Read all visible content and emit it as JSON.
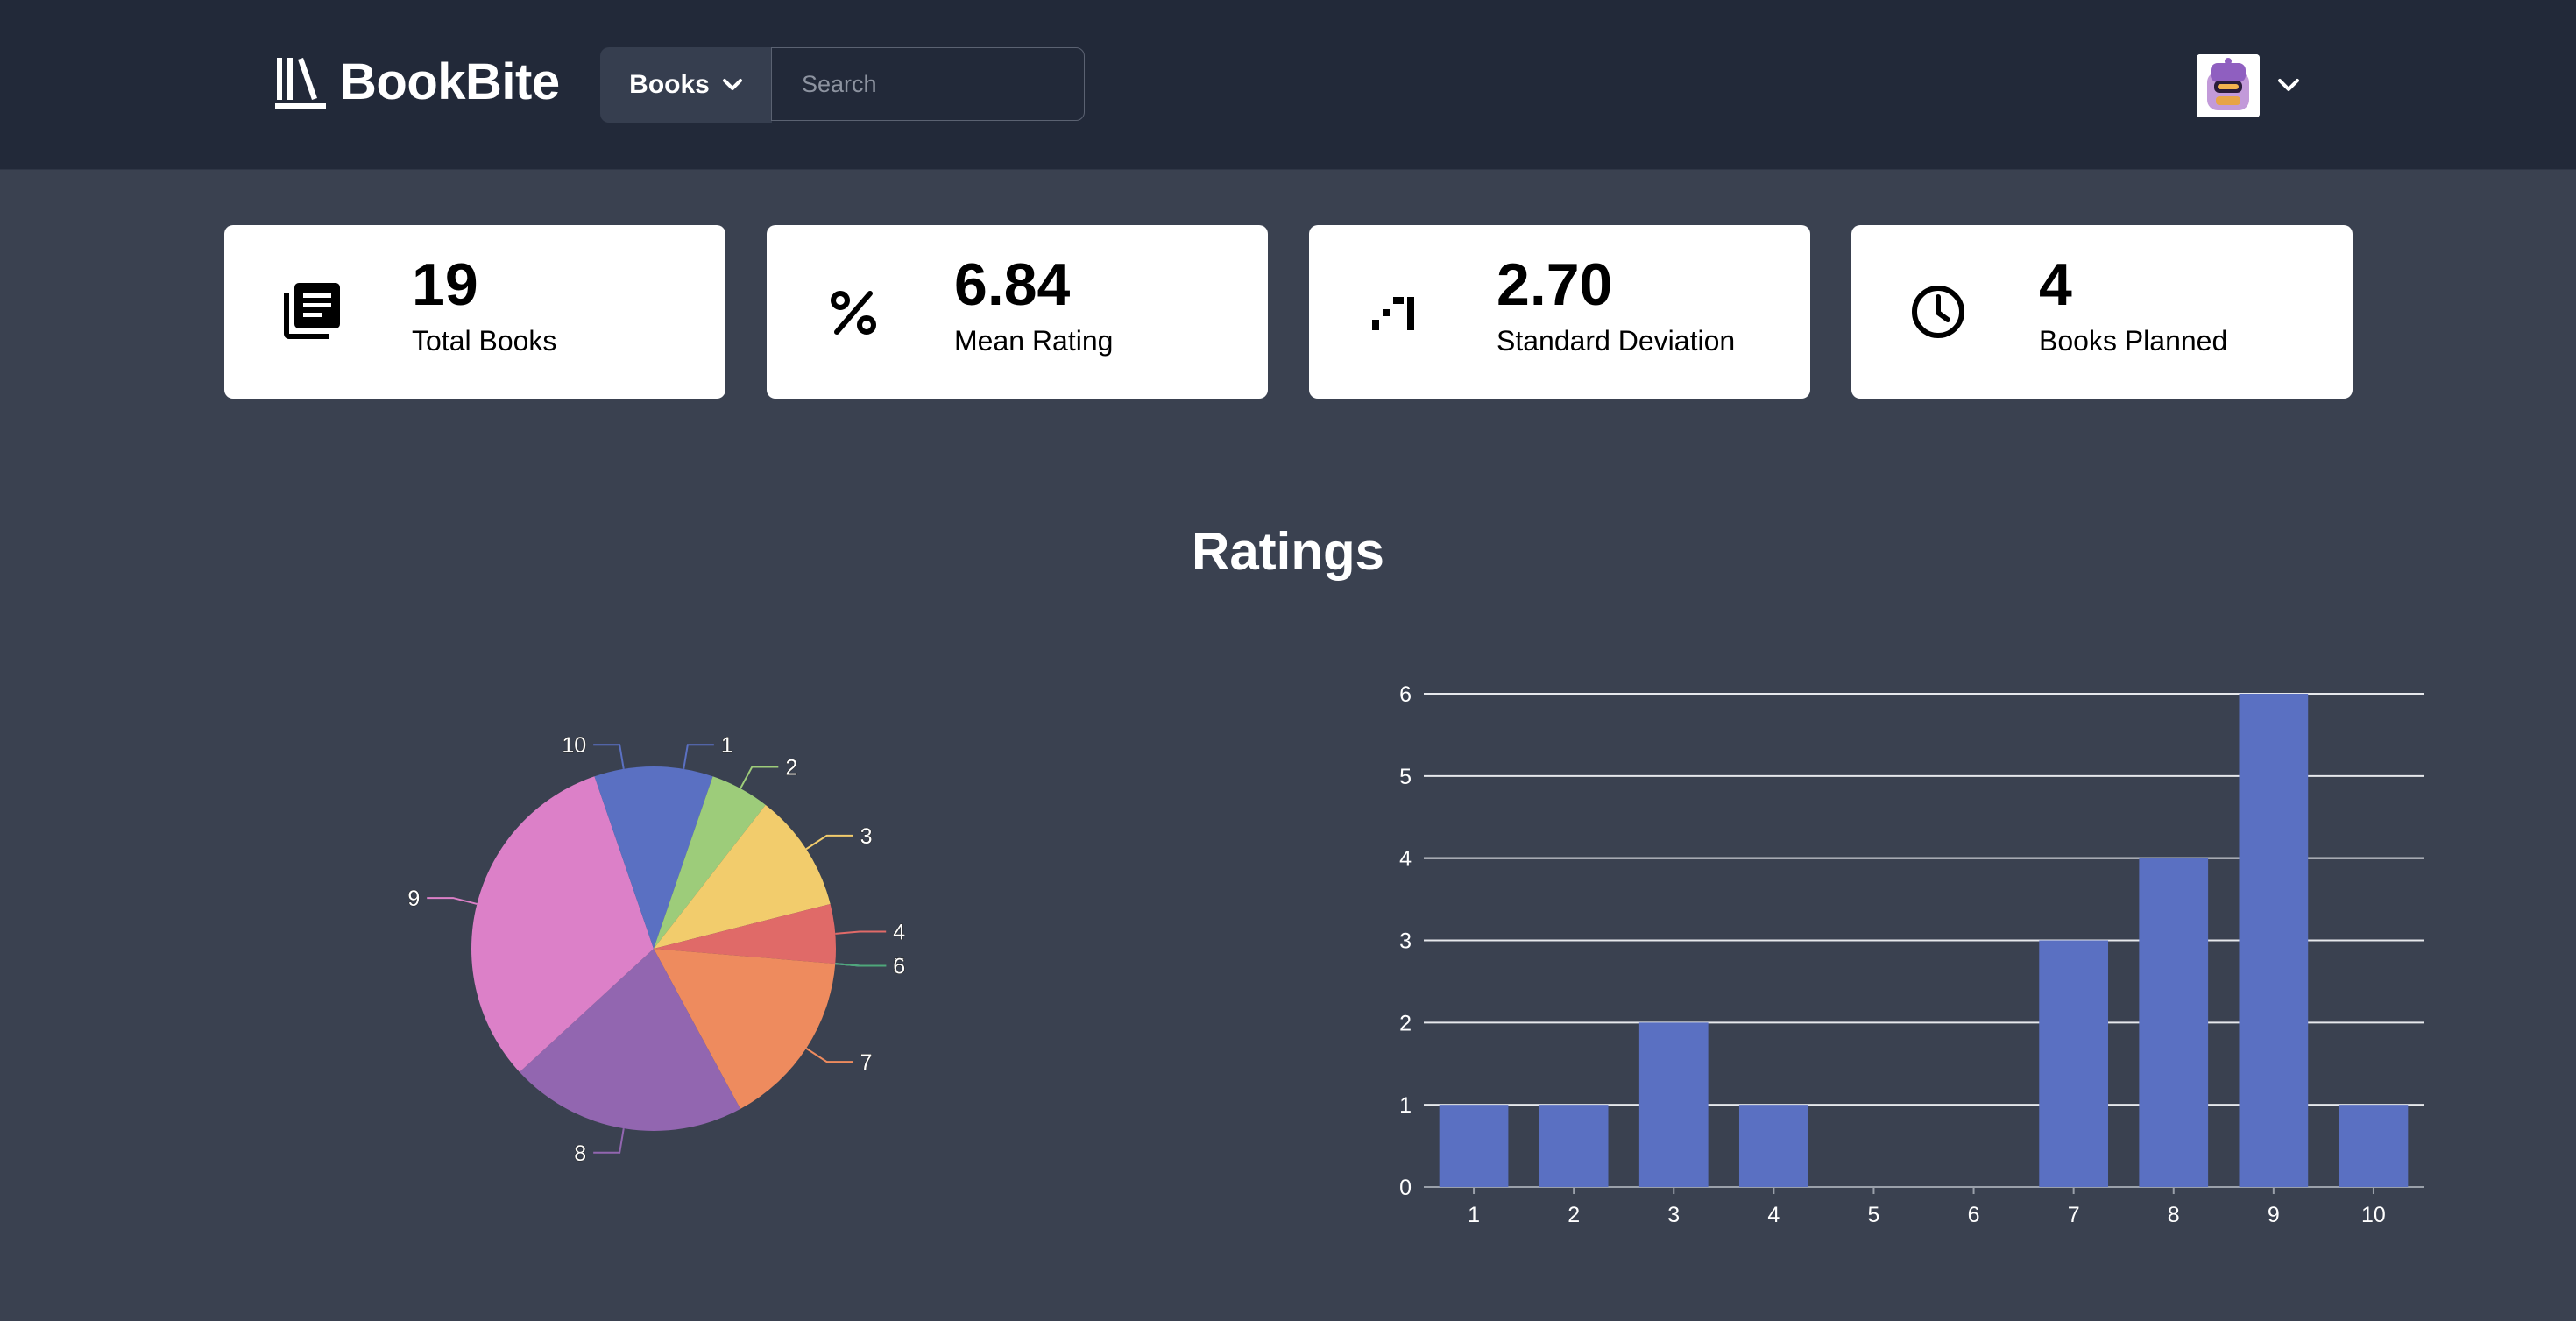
{
  "header": {
    "logo_text": "BookBite",
    "nav_button_label": "Books",
    "search_placeholder": "Search"
  },
  "stats": [
    {
      "value": "19",
      "label": "Total Books",
      "icon": "library-books-icon"
    },
    {
      "value": "6.84",
      "label": "Mean Rating",
      "icon": "percent-icon"
    },
    {
      "value": "2.70",
      "label": "Standard Deviation",
      "icon": "stairs-icon"
    },
    {
      "value": "4",
      "label": "Books Planned",
      "icon": "clock-icon"
    }
  ],
  "section": {
    "title": "Ratings"
  },
  "colors": {
    "page_bg": "#3a4150",
    "header_bg": "#222939",
    "bar": "#5a70c2",
    "pie": [
      "#5a70c2",
      "#9dcc7a",
      "#f2cc6c",
      "#e06a68",
      "#82c8db",
      "#4ea77a",
      "#ee8b5e",
      "#9266b0",
      "#dc80c8",
      "#5a70c2"
    ]
  },
  "chart_data": [
    {
      "type": "pie",
      "categories": [
        "1",
        "2",
        "3",
        "4",
        "5",
        "6",
        "7",
        "8",
        "9",
        "10"
      ],
      "values": [
        1,
        1,
        2,
        1,
        0,
        0,
        3,
        4,
        6,
        1
      ]
    },
    {
      "type": "bar",
      "categories": [
        "1",
        "2",
        "3",
        "4",
        "5",
        "6",
        "7",
        "8",
        "9",
        "10"
      ],
      "values": [
        1,
        1,
        2,
        1,
        0,
        0,
        3,
        4,
        6,
        1
      ],
      "ylim": [
        0,
        6
      ],
      "yticks": [
        "0",
        "1",
        "2",
        "3",
        "4",
        "5",
        "6"
      ],
      "grid": true
    }
  ]
}
